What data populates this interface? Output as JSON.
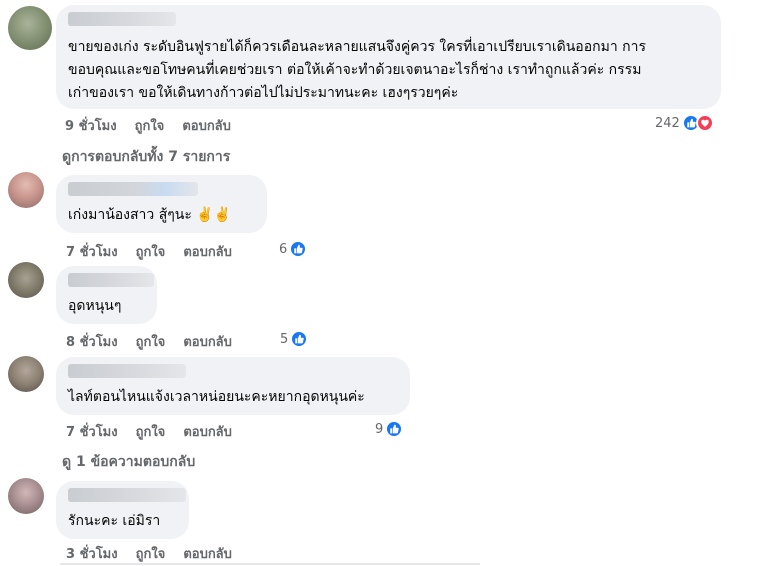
{
  "comments": [
    {
      "text_lines": [
        "ขายของเก่ง ระดับอินฟูรายได้ก็ควรเดือนละหลายแสนจึงคู่ควร ใครที่เอาเปรียบเราเดินออกมา การ",
        "ขอบคุณและขอโทษคนที่เคยช่วยเรา ต่อให้เค้าจะทำด้วยเจตนาอะไรก็ช่าง เราทำถูกแล้วค่ะ กรรม",
        "เก่าของเรา ขอให้เดินทางก้าวต่อไปไม่ประมาทนะคะ เฮงๆรวยๆค่ะ"
      ],
      "time": "9 ชั่วโมง",
      "like_label": "ถูกใจ",
      "reply_label": "ตอบกลับ",
      "reaction_count": "242",
      "reaction_icons": [
        "like-icon",
        "love-icon"
      ]
    },
    {
      "text_lines": [
        "เก่งมาน้องสาว สู้ๆนะ ✌️✌️"
      ],
      "time": "7 ชั่วโมง",
      "like_label": "ถูกใจ",
      "reply_label": "ตอบกลับ",
      "reaction_count": "6",
      "reaction_icons": [
        "like-icon"
      ]
    },
    {
      "text_lines": [
        "อุดหนุนๆ"
      ],
      "time": "8 ชั่วโมง",
      "like_label": "ถูกใจ",
      "reply_label": "ตอบกลับ",
      "reaction_count": "5",
      "reaction_icons": [
        "like-icon"
      ]
    },
    {
      "text_lines": [
        "ไลท์ตอนไหนแจ้งเวลาหน่อยนะคะหยากอุดหนุนค่ะ"
      ],
      "time": "7 ชั่วโมง",
      "like_label": "ถูกใจ",
      "reply_label": "ตอบกลับ",
      "reaction_count": "9",
      "reaction_icons": [
        "like-icon"
      ]
    },
    {
      "text_lines": [
        "รักนะคะ เอ่มิรา"
      ],
      "time": "3 ชั่วโมง",
      "like_label": "ถูกใจ",
      "reply_label": "ตอบกลับ"
    }
  ],
  "view_all_replies": "ดูการตอบกลับทั้ง 7 รายการ",
  "view_one_reply": "ดู 1 ข้อความตอบกลับ",
  "colors": {
    "bubble": "#f0f2f5",
    "meta_text": "#65676b",
    "like_blue": "#1877f2",
    "love_red": "#f33e58"
  }
}
